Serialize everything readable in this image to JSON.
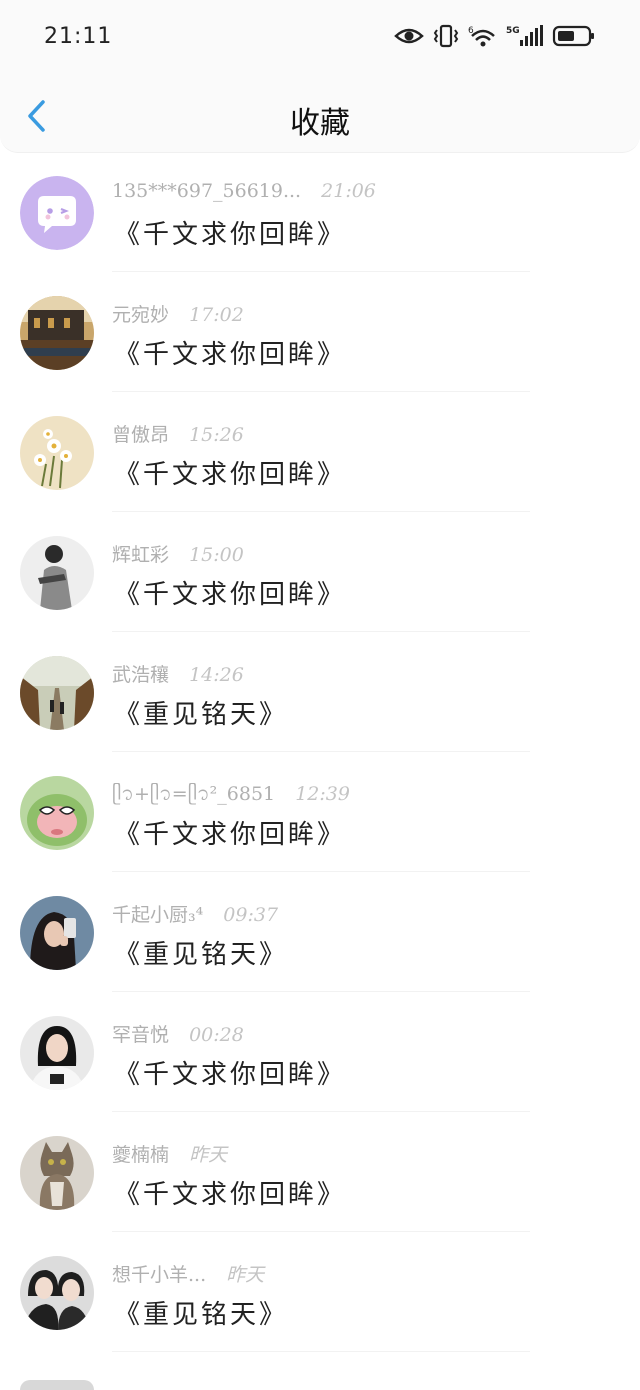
{
  "status_bar": {
    "time": "21:11",
    "network": "5G"
  },
  "header": {
    "title": "收藏"
  },
  "items": [
    {
      "name": "135***697_56619...",
      "time": "21:06",
      "title": "《千文求你回眸》",
      "avatar": "chat-bubble-icon"
    },
    {
      "name": "元宛妙",
      "time": "17:02",
      "title": "《千文求你回眸》",
      "avatar": "building-photo"
    },
    {
      "name": "曾傲昂",
      "time": "15:26",
      "title": "《千文求你回眸》",
      "avatar": "daisy-photo"
    },
    {
      "name": "辉虹彩",
      "time": "15:00",
      "title": "《千文求你回眸》",
      "avatar": "person-photo"
    },
    {
      "name": "武浩穰",
      "time": "14:26",
      "title": "《重见铭天》",
      "avatar": "path-photo"
    },
    {
      "name": "ᥫ᭡+ᥫ᭡=ᥫ᭡²_6851",
      "time": "12:39",
      "title": "《千文求你回眸》",
      "avatar": "frog-photo"
    },
    {
      "name": "千起小厨₃⁴",
      "time": "09:37",
      "title": "《重见铭天》",
      "avatar": "girl-photo"
    },
    {
      "name": "罕音悦",
      "time": "00:28",
      "title": "《千文求你回眸》",
      "avatar": "woman-photo"
    },
    {
      "name": "夔楠楠",
      "time": "昨天",
      "title": "《千文求你回眸》",
      "avatar": "cat-photo"
    },
    {
      "name": "想千小羊...",
      "time": "昨天",
      "title": "《重见铭天》",
      "avatar": "couple-photo"
    }
  ]
}
